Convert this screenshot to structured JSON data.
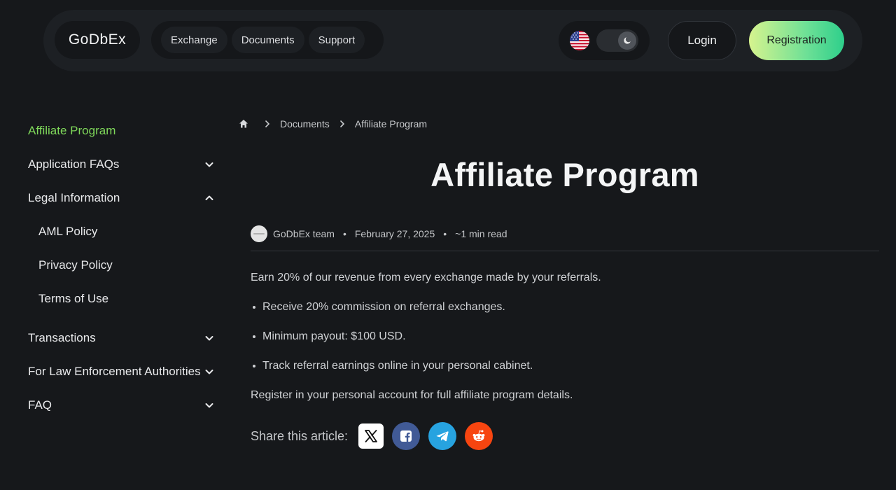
{
  "header": {
    "logo": "GoDbEx",
    "nav": [
      "Exchange",
      "Documents",
      "Support"
    ],
    "language_icon": "us-flag-icon",
    "theme_toggle_icon": "moon-icon",
    "login": "Login",
    "registration": "Registration"
  },
  "sidebar": {
    "items": [
      {
        "label": "Affiliate Program",
        "active": true
      },
      {
        "label": "Application FAQs",
        "chevron": "down"
      },
      {
        "label": "Legal Information",
        "chevron": "up"
      },
      {
        "label": "AML Policy"
      },
      {
        "label": "Privacy Policy"
      },
      {
        "label": "Terms of Use"
      },
      {
        "label": "Transactions",
        "chevron": "down"
      },
      {
        "label": "For Law Enforcement Authorities",
        "chevron": "down"
      },
      {
        "label": "FAQ",
        "chevron": "down"
      }
    ]
  },
  "breadcrumb": {
    "home_icon": "home-icon",
    "items": [
      "Documents",
      "Affiliate Program"
    ]
  },
  "article": {
    "title": "Affiliate Program",
    "author": "GoDbEx team",
    "date": "February 27, 2025",
    "read_time": "~1 min read",
    "intro": "Earn 20% of our revenue from every exchange made by your referrals.",
    "bullets": [
      "Receive 20% commission on referral exchanges.",
      "Minimum payout: $100 USD.",
      "Track referral earnings online in your personal cabinet."
    ],
    "outro": "Register in your personal account for full affiliate program details.",
    "share_label": "Share this article:"
  },
  "colors": {
    "background": "#16181b",
    "accent_green": "#7fd85a",
    "registration_gradient_start": "#d6f38e",
    "registration_gradient_end": "#2ecf8b",
    "facebook": "#415a96",
    "telegram": "#27a3e0",
    "reddit": "#f74510"
  }
}
